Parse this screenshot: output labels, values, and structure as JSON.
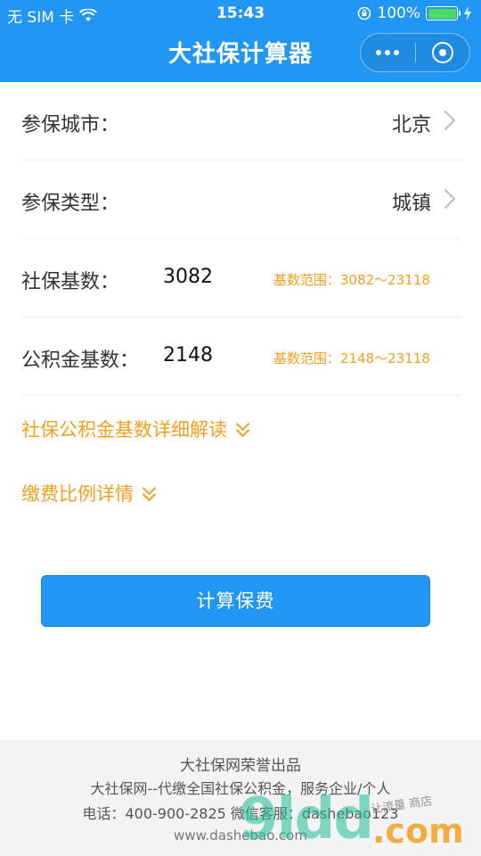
{
  "status_bar": {
    "carrier": "无 SIM 卡",
    "time": "15:43",
    "battery": "100%",
    "battery_level": 1.0
  },
  "nav": {
    "title": "大社保计算器"
  },
  "form": {
    "city": {
      "label": "参保城市：",
      "value": "北京"
    },
    "type": {
      "label": "参保类型：",
      "value": "城镇"
    },
    "social_base": {
      "label": "社保基数：",
      "value": "3082",
      "range": "基数范围：3082～23118"
    },
    "fund_base": {
      "label": "公积金基数：",
      "value": "2148",
      "range": "基数范围：2148～23118"
    }
  },
  "links": {
    "detail": "社保公积金基数详细解读",
    "ratio": "缴费比例详情"
  },
  "calc_button": "计算保费",
  "footer": {
    "line1": "大社保网荣誉出品",
    "line2": "大社保网--代缴全国社保公积金，服务企业/个人",
    "line3": "电话：400-900-2825 微信客服：dashebao123",
    "line4": "www.dashebao.com"
  },
  "watermark": {
    "brand": "9ldd",
    "domain": ".com",
    "tagline": "让流量 商店"
  },
  "colors": {
    "primary": "#2196F3",
    "accent": "#f0a020"
  }
}
